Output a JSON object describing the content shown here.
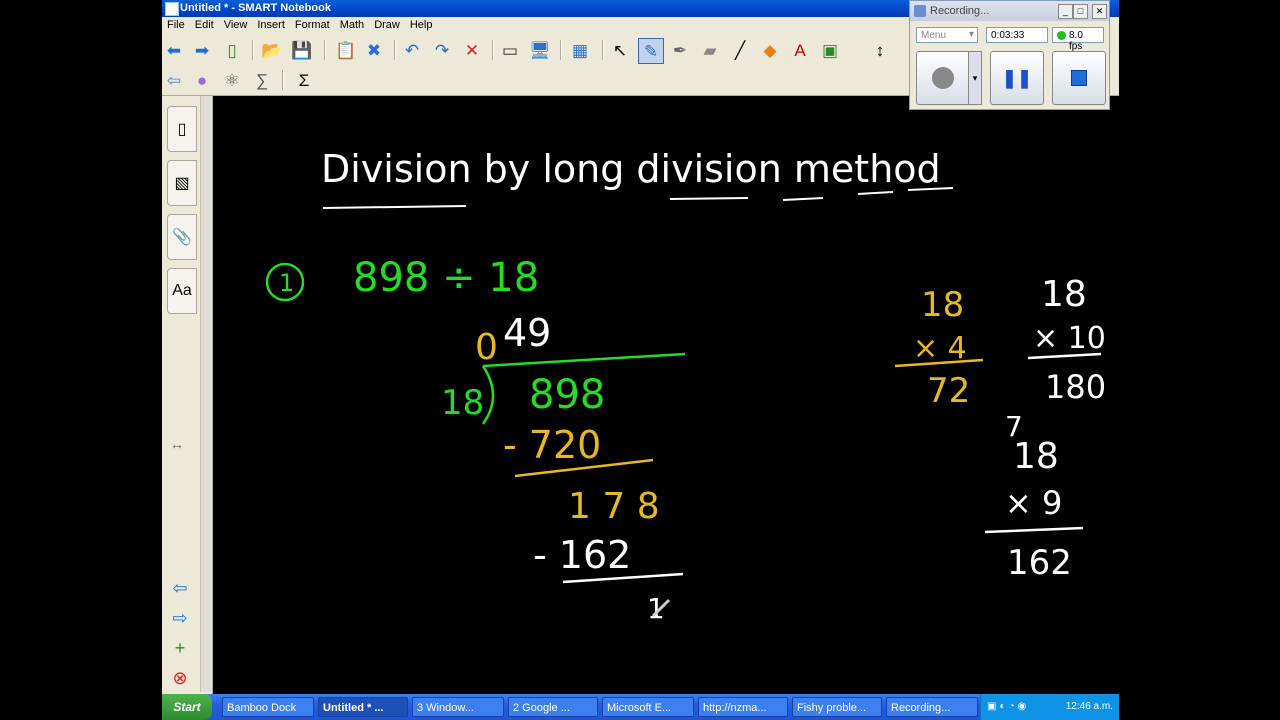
{
  "window": {
    "title": "Untitled * - SMART Notebook"
  },
  "menu": [
    "File",
    "Edit",
    "View",
    "Insert",
    "Format",
    "Math",
    "Draw",
    "Help"
  ],
  "toolbar1": [
    {
      "name": "back-icon",
      "glyph": "⬅",
      "color": "#1e6fd9"
    },
    {
      "name": "forward-icon",
      "glyph": "➡",
      "color": "#1e6fd9"
    },
    {
      "name": "add-page-icon",
      "glyph": "▯",
      "color": "#2a8a2a"
    },
    {
      "name": "open-icon",
      "glyph": "📂",
      "color": "#c8a030"
    },
    {
      "name": "save-icon",
      "glyph": "💾",
      "color": "#2b55b8"
    },
    {
      "name": "paste-icon",
      "glyph": "📋",
      "color": "#555"
    },
    {
      "name": "delete-page-icon",
      "glyph": "✖",
      "color": "#2b6fd0"
    },
    {
      "name": "undo-icon",
      "glyph": "↶",
      "color": "#1e6fd9"
    },
    {
      "name": "redo-icon",
      "glyph": "↷",
      "color": "#1e6fd9"
    },
    {
      "name": "delete-icon",
      "glyph": "✕",
      "color": "#d22"
    },
    {
      "name": "screen-shade-icon",
      "glyph": "▭",
      "color": "#333"
    },
    {
      "name": "display-icon",
      "glyph": "🖥",
      "color": "#2b6fd0"
    },
    {
      "name": "table-icon",
      "glyph": "▦",
      "color": "#2b6fd0"
    },
    {
      "name": "select-icon",
      "glyph": "↖",
      "color": "#000"
    },
    {
      "name": "pen-icon",
      "glyph": "✎",
      "color": "#1e6fd9"
    },
    {
      "name": "creative-pen-icon",
      "glyph": "✒",
      "color": "#666"
    },
    {
      "name": "eraser-icon",
      "glyph": "▰",
      "color": "#888"
    },
    {
      "name": "line-icon",
      "glyph": "╱",
      "color": "#000"
    },
    {
      "name": "shapes-icon",
      "glyph": "◆",
      "color": "#e8801a"
    },
    {
      "name": "text-icon",
      "glyph": "A",
      "color": "#c00"
    },
    {
      "name": "fill-icon",
      "glyph": "▣",
      "color": "#2a8a2a"
    },
    {
      "name": "properties-icon",
      "glyph": "↕",
      "color": "#000"
    }
  ],
  "toolbar2": [
    {
      "name": "move-toolbar-icon",
      "glyph": "⇦",
      "color": "#4a7fe0"
    },
    {
      "name": "magic-pen-icon",
      "glyph": "●",
      "color": "#9b6bd6"
    },
    {
      "name": "shape-recognition-icon",
      "glyph": "⚛",
      "color": "#555"
    },
    {
      "name": "math-tools-icon",
      "glyph": "∑",
      "color": "#555"
    },
    {
      "name": "sigma-icon",
      "glyph": "Σ",
      "color": "#000"
    }
  ],
  "sidebar": [
    {
      "name": "page-sorter-tab-icon",
      "glyph": "▯"
    },
    {
      "name": "gallery-tab-icon",
      "glyph": "▧"
    },
    {
      "name": "attachments-tab-icon",
      "glyph": "📎"
    },
    {
      "name": "properties-tab-icon",
      "glyph": "Aa"
    }
  ],
  "sidebar_bottom": [
    {
      "name": "prev-page-icon",
      "glyph": "⇦",
      "color": "#1e6fd9"
    },
    {
      "name": "next-page-icon",
      "glyph": "⇨",
      "color": "#1e6fd9"
    },
    {
      "name": "add-page-icon",
      "glyph": "+",
      "color": "#2a8a2a"
    },
    {
      "name": "delete-page-icon",
      "glyph": "⊗",
      "color": "#d22"
    }
  ],
  "resize_handle": "↔",
  "canvas": {
    "heading": "Division by long division method",
    "problem_number": "1",
    "problem": "898 ÷ 18",
    "quotient_zero": "0",
    "quotient": "49",
    "divisor": "18",
    "dividend": "898",
    "sub1": "- 720",
    "rem1": "1 7 8",
    "sub2": "- 162",
    "partial": "1",
    "work": {
      "a_top": "18",
      "a_mult": "× 4",
      "a_res": "72",
      "b_top": "18",
      "b_mult": "× 10",
      "b_res": "180",
      "c_mark": "7",
      "c_top": "18",
      "c_mult": "× 9",
      "c_res": "162"
    },
    "colors": {
      "white": "#ffffff",
      "green": "#22dd22",
      "gold": "#e8b820"
    }
  },
  "recorder": {
    "title": "Recording...",
    "menu_label": "Menu",
    "time": "0:03:33",
    "fps": "8.0 fps"
  },
  "taskbar": {
    "start": "Start",
    "tasks": [
      "Bamboo Dock",
      "Untitled * ...",
      "3 Window...",
      "2 Google ...",
      "Microsoft E...",
      "http://nzma...",
      "Fishy proble...",
      "Recording..."
    ],
    "clock": "12:46 a.m."
  }
}
